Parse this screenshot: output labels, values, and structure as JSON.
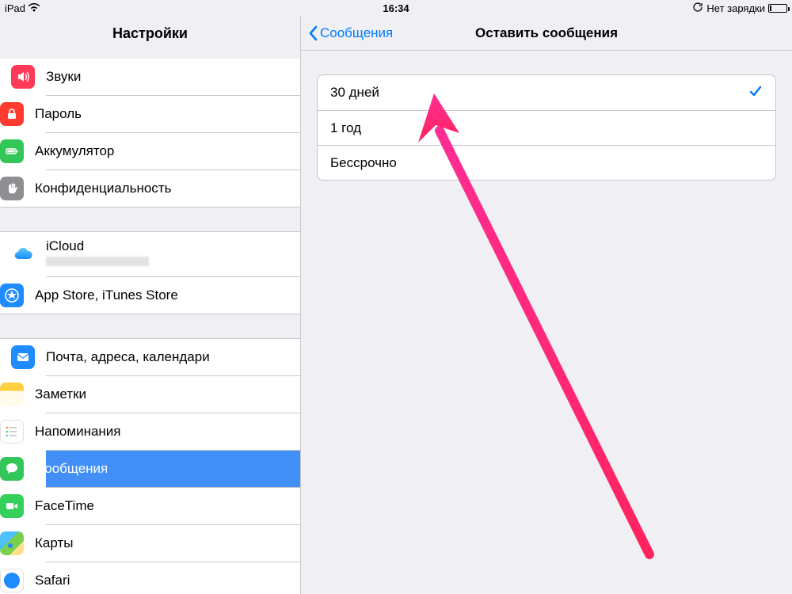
{
  "statusbar": {
    "device": "iPad",
    "time": "16:34",
    "charging_text": "Нет зарядки"
  },
  "sidebar": {
    "title": "Настройки",
    "groups": [
      {
        "items": [
          {
            "id": "sounds",
            "label": "Звуки"
          },
          {
            "id": "passcode",
            "label": "Пароль"
          },
          {
            "id": "battery",
            "label": "Аккумулятор"
          },
          {
            "id": "privacy",
            "label": "Конфиденциальность"
          }
        ]
      },
      {
        "items": [
          {
            "id": "icloud",
            "label": "iCloud"
          },
          {
            "id": "appstore",
            "label": "App Store, iTunes Store"
          }
        ]
      },
      {
        "items": [
          {
            "id": "mail",
            "label": "Почта, адреса, календари"
          },
          {
            "id": "notes",
            "label": "Заметки"
          },
          {
            "id": "reminders",
            "label": "Напоминания"
          },
          {
            "id": "messages",
            "label": "Сообщения"
          },
          {
            "id": "facetime",
            "label": "FaceTime"
          },
          {
            "id": "maps",
            "label": "Карты"
          },
          {
            "id": "safari",
            "label": "Safari"
          }
        ]
      }
    ]
  },
  "detail": {
    "back_label": "Сообщения",
    "title": "Оставить сообщения",
    "options": [
      {
        "id": "30d",
        "label": "30 дней",
        "selected": true
      },
      {
        "id": "1y",
        "label": "1 год",
        "selected": false
      },
      {
        "id": "forever",
        "label": "Бессрочно",
        "selected": false
      }
    ]
  }
}
